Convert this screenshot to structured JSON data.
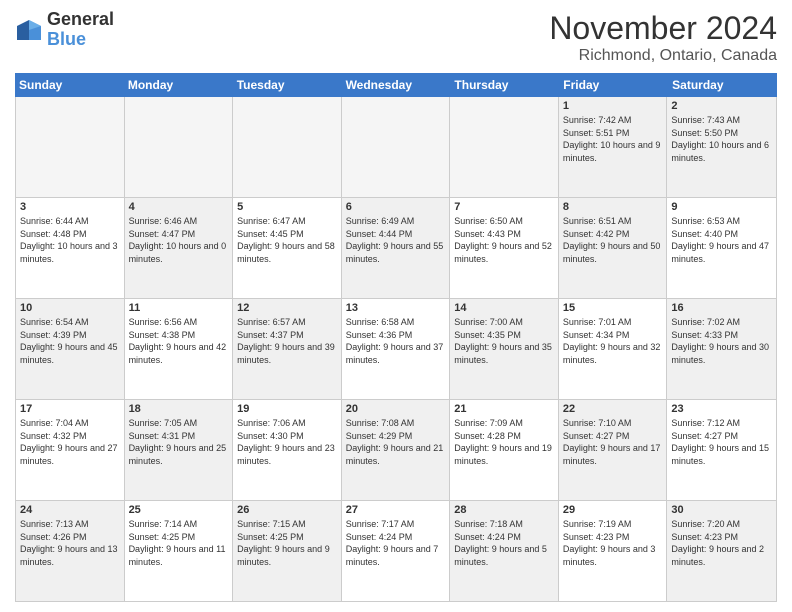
{
  "logo": {
    "line1": "General",
    "line2": "Blue"
  },
  "title": "November 2024",
  "subtitle": "Richmond, Ontario, Canada",
  "days": [
    "Sunday",
    "Monday",
    "Tuesday",
    "Wednesday",
    "Thursday",
    "Friday",
    "Saturday"
  ],
  "rows": [
    [
      {
        "day": "",
        "info": "",
        "empty": true
      },
      {
        "day": "",
        "info": "",
        "empty": true
      },
      {
        "day": "",
        "info": "",
        "empty": true
      },
      {
        "day": "",
        "info": "",
        "empty": true
      },
      {
        "day": "",
        "info": "",
        "empty": true
      },
      {
        "day": "1",
        "info": "Sunrise: 7:42 AM\nSunset: 5:51 PM\nDaylight: 10 hours and 9 minutes.",
        "shaded": true
      },
      {
        "day": "2",
        "info": "Sunrise: 7:43 AM\nSunset: 5:50 PM\nDaylight: 10 hours and 6 minutes.",
        "shaded": true
      }
    ],
    [
      {
        "day": "3",
        "info": "Sunrise: 6:44 AM\nSunset: 4:48 PM\nDaylight: 10 hours and 3 minutes."
      },
      {
        "day": "4",
        "info": "Sunrise: 6:46 AM\nSunset: 4:47 PM\nDaylight: 10 hours and 0 minutes.",
        "shaded": true
      },
      {
        "day": "5",
        "info": "Sunrise: 6:47 AM\nSunset: 4:45 PM\nDaylight: 9 hours and 58 minutes."
      },
      {
        "day": "6",
        "info": "Sunrise: 6:49 AM\nSunset: 4:44 PM\nDaylight: 9 hours and 55 minutes.",
        "shaded": true
      },
      {
        "day": "7",
        "info": "Sunrise: 6:50 AM\nSunset: 4:43 PM\nDaylight: 9 hours and 52 minutes."
      },
      {
        "day": "8",
        "info": "Sunrise: 6:51 AM\nSunset: 4:42 PM\nDaylight: 9 hours and 50 minutes.",
        "shaded": true
      },
      {
        "day": "9",
        "info": "Sunrise: 6:53 AM\nSunset: 4:40 PM\nDaylight: 9 hours and 47 minutes."
      }
    ],
    [
      {
        "day": "10",
        "info": "Sunrise: 6:54 AM\nSunset: 4:39 PM\nDaylight: 9 hours and 45 minutes.",
        "shaded": true
      },
      {
        "day": "11",
        "info": "Sunrise: 6:56 AM\nSunset: 4:38 PM\nDaylight: 9 hours and 42 minutes."
      },
      {
        "day": "12",
        "info": "Sunrise: 6:57 AM\nSunset: 4:37 PM\nDaylight: 9 hours and 39 minutes.",
        "shaded": true
      },
      {
        "day": "13",
        "info": "Sunrise: 6:58 AM\nSunset: 4:36 PM\nDaylight: 9 hours and 37 minutes."
      },
      {
        "day": "14",
        "info": "Sunrise: 7:00 AM\nSunset: 4:35 PM\nDaylight: 9 hours and 35 minutes.",
        "shaded": true
      },
      {
        "day": "15",
        "info": "Sunrise: 7:01 AM\nSunset: 4:34 PM\nDaylight: 9 hours and 32 minutes."
      },
      {
        "day": "16",
        "info": "Sunrise: 7:02 AM\nSunset: 4:33 PM\nDaylight: 9 hours and 30 minutes.",
        "shaded": true
      }
    ],
    [
      {
        "day": "17",
        "info": "Sunrise: 7:04 AM\nSunset: 4:32 PM\nDaylight: 9 hours and 27 minutes."
      },
      {
        "day": "18",
        "info": "Sunrise: 7:05 AM\nSunset: 4:31 PM\nDaylight: 9 hours and 25 minutes.",
        "shaded": true
      },
      {
        "day": "19",
        "info": "Sunrise: 7:06 AM\nSunset: 4:30 PM\nDaylight: 9 hours and 23 minutes."
      },
      {
        "day": "20",
        "info": "Sunrise: 7:08 AM\nSunset: 4:29 PM\nDaylight: 9 hours and 21 minutes.",
        "shaded": true
      },
      {
        "day": "21",
        "info": "Sunrise: 7:09 AM\nSunset: 4:28 PM\nDaylight: 9 hours and 19 minutes."
      },
      {
        "day": "22",
        "info": "Sunrise: 7:10 AM\nSunset: 4:27 PM\nDaylight: 9 hours and 17 minutes.",
        "shaded": true
      },
      {
        "day": "23",
        "info": "Sunrise: 7:12 AM\nSunset: 4:27 PM\nDaylight: 9 hours and 15 minutes."
      }
    ],
    [
      {
        "day": "24",
        "info": "Sunrise: 7:13 AM\nSunset: 4:26 PM\nDaylight: 9 hours and 13 minutes.",
        "shaded": true
      },
      {
        "day": "25",
        "info": "Sunrise: 7:14 AM\nSunset: 4:25 PM\nDaylight: 9 hours and 11 minutes."
      },
      {
        "day": "26",
        "info": "Sunrise: 7:15 AM\nSunset: 4:25 PM\nDaylight: 9 hours and 9 minutes.",
        "shaded": true
      },
      {
        "day": "27",
        "info": "Sunrise: 7:17 AM\nSunset: 4:24 PM\nDaylight: 9 hours and 7 minutes."
      },
      {
        "day": "28",
        "info": "Sunrise: 7:18 AM\nSunset: 4:24 PM\nDaylight: 9 hours and 5 minutes.",
        "shaded": true
      },
      {
        "day": "29",
        "info": "Sunrise: 7:19 AM\nSunset: 4:23 PM\nDaylight: 9 hours and 3 minutes."
      },
      {
        "day": "30",
        "info": "Sunrise: 7:20 AM\nSunset: 4:23 PM\nDaylight: 9 hours and 2 minutes.",
        "shaded": true
      }
    ]
  ]
}
